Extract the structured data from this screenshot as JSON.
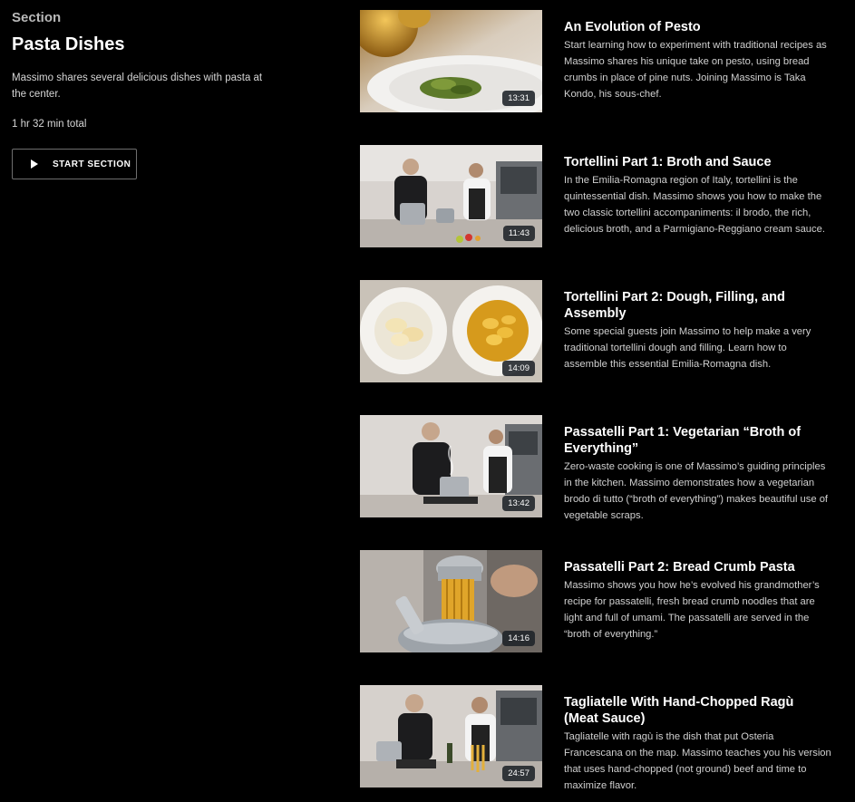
{
  "section": {
    "kicker": "Section",
    "title": "Pasta Dishes",
    "description": "Massimo shares several delicious dishes with pasta at the center.",
    "total": "1 hr 32 min total",
    "start_label": "START SECTION"
  },
  "lessons": [
    {
      "title": "An Evolution of Pesto",
      "description": "Start learning how to experiment with traditional recipes as Massimo shares his unique take on pesto, using bread crumbs in place of pine nuts. Joining Massimo is Taka Kondo, his sous-chef.",
      "duration": "13:31",
      "thumbnail": "pesto-bowl"
    },
    {
      "title": "Tortellini Part 1: Broth and Sauce",
      "description": "In the Emilia-Romagna region of Italy, tortellini is the quintessential dish. Massimo shows you how to make the two classic tortellini accompaniments: il brodo, the rich, delicious broth, and a Parmigiano-Reggiano cream sauce.",
      "duration": "11:43",
      "thumbnail": "kitchen-two-chefs"
    },
    {
      "title": "Tortellini Part 2: Dough, Filling, and Assembly",
      "description": "Some special guests join Massimo to help make a very traditional tortellini dough and filling. Learn how to assemble this essential Emilia-Romagna dish.",
      "duration": "14:09",
      "thumbnail": "two-tortellini-bowls"
    },
    {
      "title": "Passatelli Part 1: Vegetarian “Broth of Everything”",
      "description": "Zero-waste cooking is one of Massimo’s guiding principles in the kitchen. Massimo demonstrates how a vegetarian brodo di tutto (“broth of everything”) makes beautiful use of vegetable scraps.",
      "duration": "13:42",
      "thumbnail": "kitchen-two-chefs-pot"
    },
    {
      "title": "Passatelli Part 2: Bread Crumb Pasta",
      "description": "Massimo shows you how he’s evolved his grandmother’s recipe for passatelli, fresh bread crumb noodles that are light and full of umami. The passatelli are served in the “broth of everything.”",
      "duration": "14:16",
      "thumbnail": "passatelli-press"
    },
    {
      "title": "Tagliatelle With Hand-Chopped Ragù (Meat Sauce)",
      "description": "Tagliatelle with ragù is the dish that put Osteria Francescana on the map. Massimo teaches you his version that uses hand-chopped (not ground) beef and time to maximize flavor.",
      "duration": "24:57",
      "thumbnail": "kitchen-tagliatelle"
    }
  ]
}
